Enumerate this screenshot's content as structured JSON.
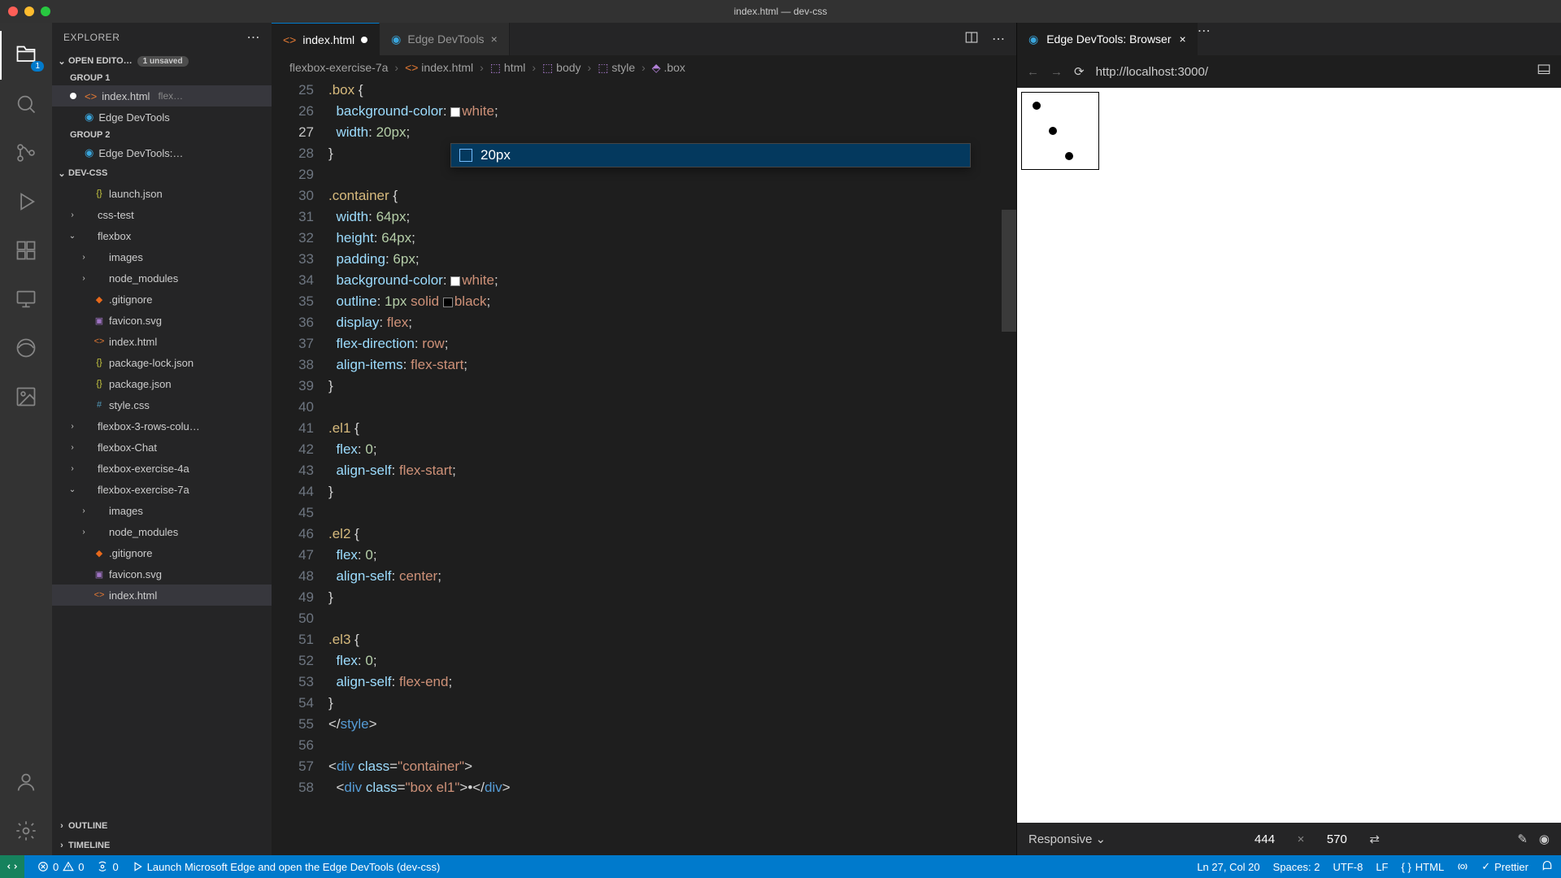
{
  "window": {
    "title": "index.html — dev-css"
  },
  "activitybar": {
    "badge": "1"
  },
  "sidebar": {
    "title": "EXPLORER",
    "openEditors": {
      "label": "OPEN EDITO…",
      "unsaved": "1 unsaved",
      "group1": "GROUP 1",
      "group2": "GROUP 2",
      "items": [
        {
          "name": "index.html",
          "dim": "flex…",
          "modified": true,
          "icon": "html"
        },
        {
          "name": "Edge DevTools",
          "icon": "edge"
        }
      ],
      "items2": [
        {
          "name": "Edge DevTools:…",
          "icon": "edge"
        }
      ]
    },
    "project": {
      "label": "DEV-CSS",
      "tree": [
        {
          "depth": 1,
          "chev": "",
          "icon": "json",
          "name": "launch.json"
        },
        {
          "depth": 0,
          "chev": "›",
          "icon": "folder",
          "name": "css-test"
        },
        {
          "depth": 0,
          "chev": "⌄",
          "icon": "folder",
          "name": "flexbox"
        },
        {
          "depth": 1,
          "chev": "›",
          "icon": "folder",
          "name": "images"
        },
        {
          "depth": 1,
          "chev": "›",
          "icon": "folder",
          "name": "node_modules"
        },
        {
          "depth": 1,
          "chev": "",
          "icon": "git",
          "name": ".gitignore"
        },
        {
          "depth": 1,
          "chev": "",
          "icon": "svg",
          "name": "favicon.svg"
        },
        {
          "depth": 1,
          "chev": "",
          "icon": "html",
          "name": "index.html"
        },
        {
          "depth": 1,
          "chev": "",
          "icon": "json",
          "name": "package-lock.json"
        },
        {
          "depth": 1,
          "chev": "",
          "icon": "json",
          "name": "package.json"
        },
        {
          "depth": 1,
          "chev": "",
          "icon": "css",
          "name": "style.css"
        },
        {
          "depth": 0,
          "chev": "›",
          "icon": "folder",
          "name": "flexbox-3-rows-colu…"
        },
        {
          "depth": 0,
          "chev": "›",
          "icon": "folder",
          "name": "flexbox-Chat"
        },
        {
          "depth": 0,
          "chev": "›",
          "icon": "folder",
          "name": "flexbox-exercise-4a"
        },
        {
          "depth": 0,
          "chev": "⌄",
          "icon": "folder",
          "name": "flexbox-exercise-7a"
        },
        {
          "depth": 1,
          "chev": "›",
          "icon": "folder",
          "name": "images"
        },
        {
          "depth": 1,
          "chev": "›",
          "icon": "folder",
          "name": "node_modules"
        },
        {
          "depth": 1,
          "chev": "",
          "icon": "git",
          "name": ".gitignore"
        },
        {
          "depth": 1,
          "chev": "",
          "icon": "svg",
          "name": "favicon.svg"
        },
        {
          "depth": 1,
          "chev": "",
          "icon": "html",
          "name": "index.html",
          "active": true
        }
      ]
    },
    "outline": "OUTLINE",
    "timeline": "TIMELINE"
  },
  "tabs": [
    {
      "name": "index.html",
      "icon": "html",
      "modified": true,
      "active": true
    },
    {
      "name": "Edge DevTools",
      "icon": "edge"
    }
  ],
  "breadcrumb": {
    "items": [
      "flexbox-exercise-7a",
      "index.html",
      "html",
      "body",
      "style",
      ".box"
    ]
  },
  "code": {
    "startLine": 25,
    "currentLine": 27,
    "lines": [
      [
        [
          ".box ",
          "sel"
        ],
        [
          "{",
          "punc"
        ]
      ],
      [
        [
          "  ",
          "p"
        ],
        [
          "background-color",
          "prop"
        ],
        [
          ": ",
          "punc"
        ],
        [
          "WHITE",
          "colorbox"
        ],
        [
          "white",
          "val"
        ],
        [
          ";",
          "punc"
        ]
      ],
      [
        [
          "  ",
          "p"
        ],
        [
          "width",
          "prop"
        ],
        [
          ": ",
          "punc"
        ],
        [
          "20px",
          "num"
        ],
        [
          ";",
          "punc"
        ]
      ],
      [
        [
          "}",
          "punc"
        ]
      ],
      [],
      [
        [
          ".container ",
          "sel"
        ],
        [
          "{",
          "punc"
        ]
      ],
      [
        [
          "  ",
          "p"
        ],
        [
          "width",
          "prop"
        ],
        [
          ": ",
          "punc"
        ],
        [
          "64px",
          "num"
        ],
        [
          ";",
          "punc"
        ]
      ],
      [
        [
          "  ",
          "p"
        ],
        [
          "height",
          "prop"
        ],
        [
          ": ",
          "punc"
        ],
        [
          "64px",
          "num"
        ],
        [
          ";",
          "punc"
        ]
      ],
      [
        [
          "  ",
          "p"
        ],
        [
          "padding",
          "prop"
        ],
        [
          ": ",
          "punc"
        ],
        [
          "6px",
          "num"
        ],
        [
          ";",
          "punc"
        ]
      ],
      [
        [
          "  ",
          "p"
        ],
        [
          "background-color",
          "prop"
        ],
        [
          ": ",
          "punc"
        ],
        [
          "WHITE",
          "colorbox"
        ],
        [
          "white",
          "val"
        ],
        [
          ";",
          "punc"
        ]
      ],
      [
        [
          "  ",
          "p"
        ],
        [
          "outline",
          "prop"
        ],
        [
          ": ",
          "punc"
        ],
        [
          "1px ",
          "num"
        ],
        [
          "solid ",
          "val"
        ],
        [
          "BLACK",
          "colorbox"
        ],
        [
          "black",
          "val"
        ],
        [
          ";",
          "punc"
        ]
      ],
      [
        [
          "  ",
          "p"
        ],
        [
          "display",
          "prop"
        ],
        [
          ": ",
          "punc"
        ],
        [
          "flex",
          "val"
        ],
        [
          ";",
          "punc"
        ]
      ],
      [
        [
          "  ",
          "p"
        ],
        [
          "flex-direction",
          "prop"
        ],
        [
          ": ",
          "punc"
        ],
        [
          "row",
          "val"
        ],
        [
          ";",
          "punc"
        ]
      ],
      [
        [
          "  ",
          "p"
        ],
        [
          "align-items",
          "prop"
        ],
        [
          ": ",
          "punc"
        ],
        [
          "flex-start",
          "val"
        ],
        [
          ";",
          "punc"
        ]
      ],
      [
        [
          "}",
          "punc"
        ]
      ],
      [],
      [
        [
          ".el1 ",
          "sel"
        ],
        [
          "{",
          "punc"
        ]
      ],
      [
        [
          "  ",
          "p"
        ],
        [
          "flex",
          "prop"
        ],
        [
          ": ",
          "punc"
        ],
        [
          "0",
          "num"
        ],
        [
          ";",
          "punc"
        ]
      ],
      [
        [
          "  ",
          "p"
        ],
        [
          "align-self",
          "prop"
        ],
        [
          ": ",
          "punc"
        ],
        [
          "flex-start",
          "val"
        ],
        [
          ";",
          "punc"
        ]
      ],
      [
        [
          "}",
          "punc"
        ]
      ],
      [],
      [
        [
          ".el2 ",
          "sel"
        ],
        [
          "{",
          "punc"
        ]
      ],
      [
        [
          "  ",
          "p"
        ],
        [
          "flex",
          "prop"
        ],
        [
          ": ",
          "punc"
        ],
        [
          "0",
          "num"
        ],
        [
          ";",
          "punc"
        ]
      ],
      [
        [
          "  ",
          "p"
        ],
        [
          "align-self",
          "prop"
        ],
        [
          ": ",
          "punc"
        ],
        [
          "center",
          "val"
        ],
        [
          ";",
          "punc"
        ]
      ],
      [
        [
          "}",
          "punc"
        ]
      ],
      [],
      [
        [
          ".el3 ",
          "sel"
        ],
        [
          "{",
          "punc"
        ]
      ],
      [
        [
          "  ",
          "p"
        ],
        [
          "flex",
          "prop"
        ],
        [
          ": ",
          "punc"
        ],
        [
          "0",
          "num"
        ],
        [
          ";",
          "punc"
        ]
      ],
      [
        [
          "  ",
          "p"
        ],
        [
          "align-self",
          "prop"
        ],
        [
          ": ",
          "punc"
        ],
        [
          "flex-end",
          "val"
        ],
        [
          ";",
          "punc"
        ]
      ],
      [
        [
          "}",
          "punc"
        ]
      ],
      [
        [
          "</",
          "punc"
        ],
        [
          "style",
          "tag"
        ],
        [
          ">",
          "punc"
        ]
      ],
      [],
      [
        [
          "<",
          "punc"
        ],
        [
          "div ",
          "tag"
        ],
        [
          "class",
          "attr"
        ],
        [
          "=",
          "punc"
        ],
        [
          "\"container\"",
          "str"
        ],
        [
          ">",
          "punc"
        ]
      ],
      [
        [
          "  <",
          "punc"
        ],
        [
          "div ",
          "tag"
        ],
        [
          "class",
          "attr"
        ],
        [
          "=",
          "punc"
        ],
        [
          "\"box el1\"",
          "str"
        ],
        [
          ">•</",
          "punc"
        ],
        [
          "div",
          "tag"
        ],
        [
          ">",
          "punc"
        ]
      ]
    ]
  },
  "autocomplete": {
    "item": "20px"
  },
  "browser": {
    "tabTitle": "Edge DevTools: Browser",
    "url": "http://localhost:3000/",
    "device": "Responsive",
    "width": "444",
    "height": "570"
  },
  "statusbar": {
    "errors": "0",
    "warnings": "0",
    "ports": "0",
    "launch": "Launch Microsoft Edge and open the Edge DevTools (dev-css)",
    "cursor": "Ln 27, Col 20",
    "spaces": "Spaces: 2",
    "encoding": "UTF-8",
    "eol": "LF",
    "lang": "HTML",
    "prettier": "Prettier"
  }
}
